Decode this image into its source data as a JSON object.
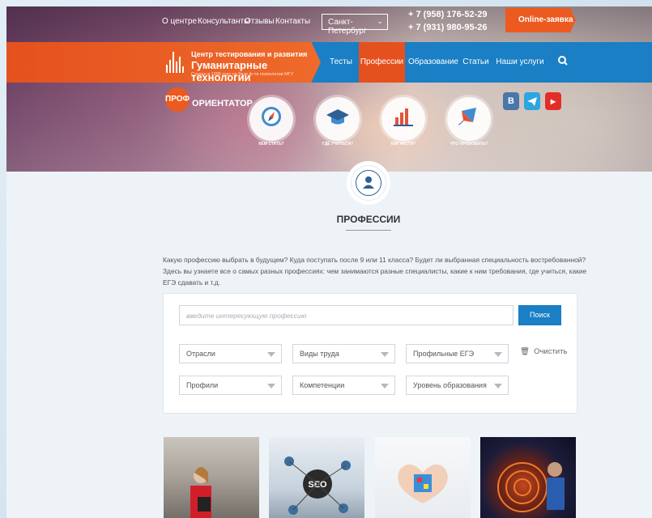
{
  "topbar": {
    "links": [
      "О центре",
      "Консультанты",
      "Отзывы",
      "Контакты"
    ],
    "city": "Санкт-Петербург",
    "phones": [
      "+ 7 (958) 176-52-29",
      "+ 7 (931) 980-95-26"
    ],
    "online_label": "Online-заявка"
  },
  "logo": {
    "line1": "Центр тестирования и развития",
    "line2": "Гуманитарные технологии",
    "line3": "Создан в 1995 году на базе ф-та психологии МГУ"
  },
  "nav": {
    "items": [
      "Тесты",
      "Профессии",
      "Образование",
      "Статьи",
      "Наши услуги"
    ],
    "active": "Профессии"
  },
  "proforientator": {
    "badge": "ПРОФ",
    "title": "ОРИЕНТАТОР",
    "circles": [
      "КЕМ СТАТЬ?",
      "ГДЕ УЧИТЬСЯ?",
      "КАК РАСТИ?",
      "ЧТО ПРОБОВАТЬ?"
    ]
  },
  "social": [
    {
      "icon": "vk-icon",
      "glyph": "В",
      "color": "#4a76a8"
    },
    {
      "icon": "telegram-icon",
      "glyph": "",
      "color": "#2ca5e0"
    },
    {
      "icon": "youtube-icon",
      "glyph": "▶",
      "color": "#e52d27"
    }
  ],
  "section": {
    "title": "ПРОФЕССИИ",
    "intro": "Какую профессию выбрать в будущем? Куда поступать после 9 или 11 класса? Будет ли выбранная специальность востребованной? Здесь вы узнаете все о самых разных профессиях: чем занимаются разные специалисты, какие к ним требования, где учиться, какие ЕГЭ сдавать и т.д."
  },
  "filters": {
    "search_placeholder": "введите интересующую профессию",
    "search_button": "Поиск",
    "selects_row1": [
      "Отрасли",
      "Виды труда",
      "Профильные ЕГЭ"
    ],
    "selects_row2": [
      "Профили",
      "Компетенции",
      "Уровень образования"
    ],
    "clear_label": "Очистить"
  },
  "colors": {
    "brand_orange": "#e5511e",
    "brand_blue": "#1a7fc4"
  }
}
